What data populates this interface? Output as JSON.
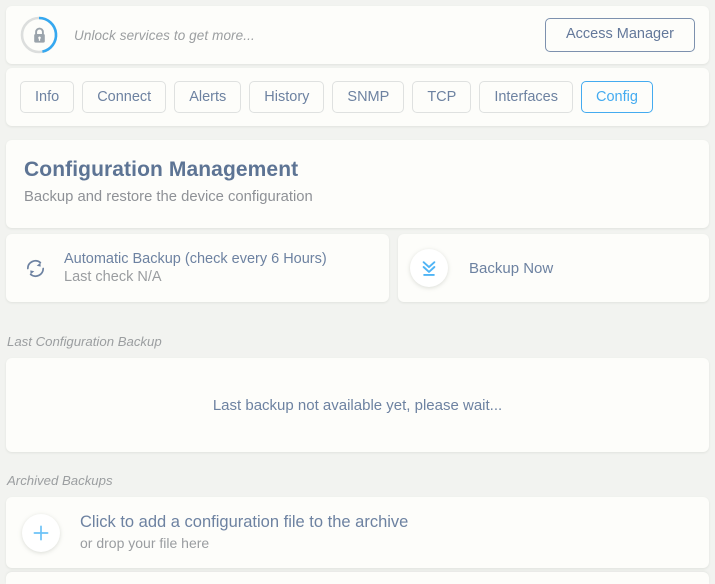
{
  "colors": {
    "background": "#f2f3f0",
    "card": "#fdfdfa",
    "accent_blue": "#44abf0",
    "slate_blue": "#6d82a1",
    "title_blue": "#5d7494",
    "muted_gray": "#9b9ea0",
    "border_gray": "#dfe1e0",
    "access_border": "#7d91ae"
  },
  "unlock_bar": {
    "lock_icon": "lock-icon",
    "message": "Unlock services to get more...",
    "access_manager_label": "Access Manager",
    "ring_progress_percent": 47
  },
  "tabs": [
    {
      "label": "Info",
      "active": false
    },
    {
      "label": "Connect",
      "active": false
    },
    {
      "label": "Alerts",
      "active": false
    },
    {
      "label": "History",
      "active": false
    },
    {
      "label": "SNMP",
      "active": false
    },
    {
      "label": "TCP",
      "active": false
    },
    {
      "label": "Interfaces",
      "active": false
    },
    {
      "label": "Config",
      "active": true
    }
  ],
  "panel": {
    "title": "Configuration Management",
    "subtitle": "Backup and restore the device configuration"
  },
  "actions": {
    "auto_backup": {
      "icon": "sync-refresh-icon",
      "title": "Automatic Backup (check every 6 Hours)",
      "status": "Last check N/A"
    },
    "backup_now": {
      "icon": "download-icon",
      "label": "Backup Now"
    }
  },
  "last_backup": {
    "section_label": "Last Configuration Backup",
    "message": "Last backup not available yet, please wait..."
  },
  "archived_backups": {
    "section_label": "Archived Backups",
    "add_icon": "plus-icon",
    "primary_text": "Click to add a configuration file to the archive",
    "secondary_text": "or drop your file here"
  }
}
